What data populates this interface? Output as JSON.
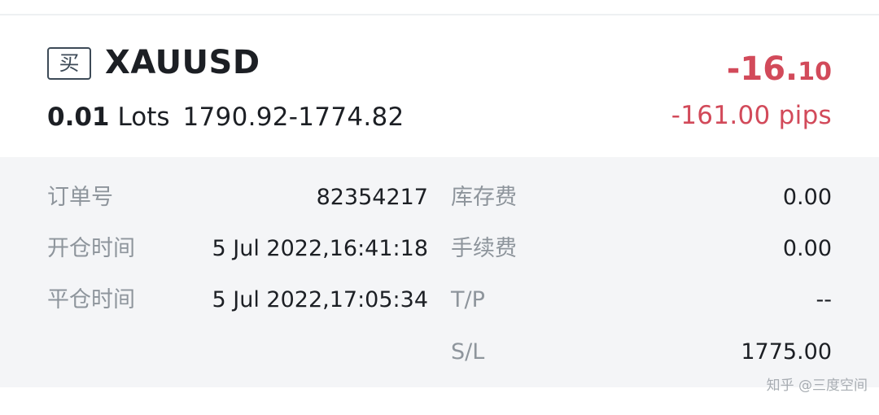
{
  "order": {
    "side_label": "买",
    "symbol": "XAUUSD",
    "lot_size": "0.01",
    "lot_unit": "Lots",
    "price_range": "1790.92-1774.82",
    "profit_major": "-16.",
    "profit_minor": "10",
    "pips": "-161.00 pips"
  },
  "details": {
    "order_no_label": "订单号",
    "order_no_value": "82354217",
    "open_time_label": "开仓时间",
    "open_time_value": "5 Jul 2022,16:41:18",
    "close_time_label": "平仓时间",
    "close_time_value": "5 Jul 2022,17:05:34",
    "swap_label": "库存费",
    "swap_value": "0.00",
    "commission_label": "手续费",
    "commission_value": "0.00",
    "tp_label": "T/P",
    "tp_value": "--",
    "sl_label": "S/L",
    "sl_value": "1775.00"
  },
  "watermark": "知乎 @三度空间",
  "colors": {
    "loss_red": "#d24a5a",
    "badge_border": "#3d4a57",
    "details_background": "#f4f5f7",
    "label_gray": "#8e959c"
  }
}
